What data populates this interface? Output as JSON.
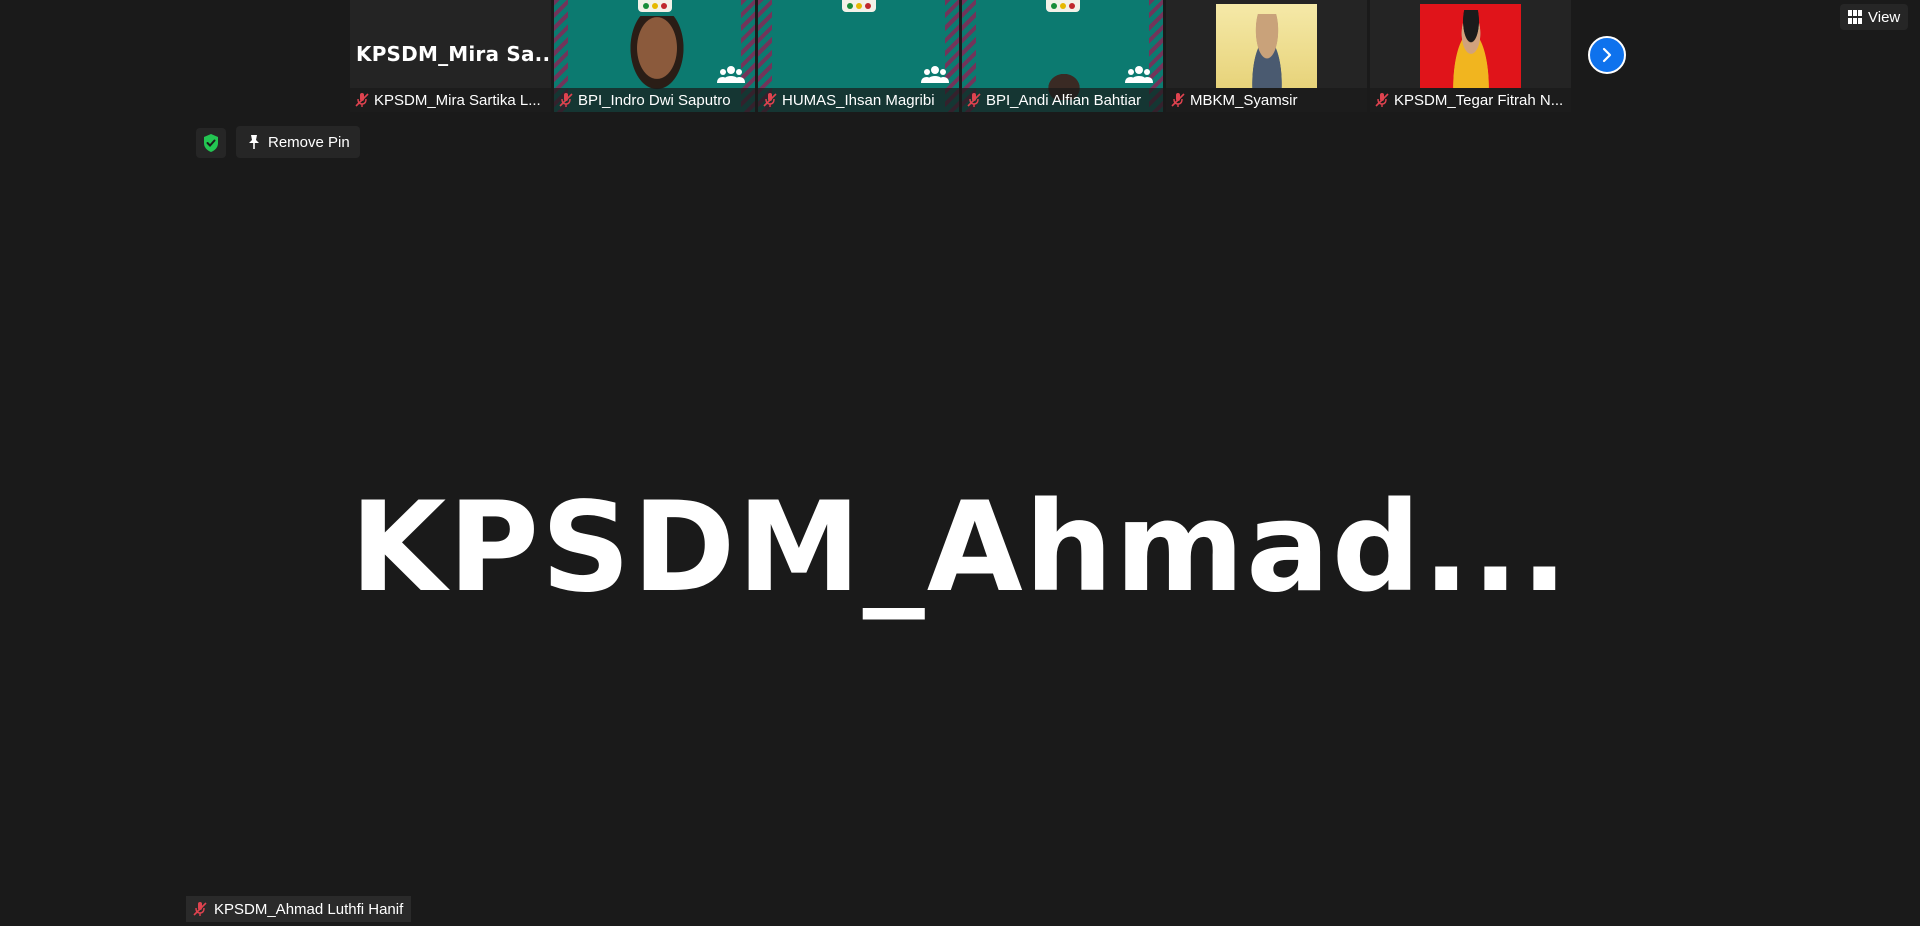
{
  "strip": {
    "tiles": [
      {
        "name": "KPSDM_Mira Sartika L...",
        "display_text": "KPSDM_Mira  Sa..."
      },
      {
        "name": "BPI_Indro Dwi Saputro"
      },
      {
        "name": "HUMAS_Ihsan Magribi"
      },
      {
        "name": "BPI_Andi Alfian Bahtiar"
      },
      {
        "name": "MBKM_Syamsir"
      },
      {
        "name": "KPSDM_Tegar Fitrah N..."
      }
    ]
  },
  "toolbar": {
    "view_label": "View",
    "remove_pin_label": "Remove Pin"
  },
  "main": {
    "speaker_display": "KPSDM_Ahmad...",
    "speaker_full_name": "KPSDM_Ahmad Luthfi Hanif"
  },
  "colors": {
    "background": "#1a1a1a",
    "accent_blue": "#0e72ed",
    "mute_red": "#e0434f",
    "shield_green": "#23c552",
    "tile_green": "#0c7a70"
  },
  "icons": {
    "mute": "mic-muted-icon",
    "view": "grid-icon",
    "pin": "pin-icon",
    "next": "chevron-right-icon",
    "shield": "shield-check-icon",
    "people": "people-icon"
  }
}
